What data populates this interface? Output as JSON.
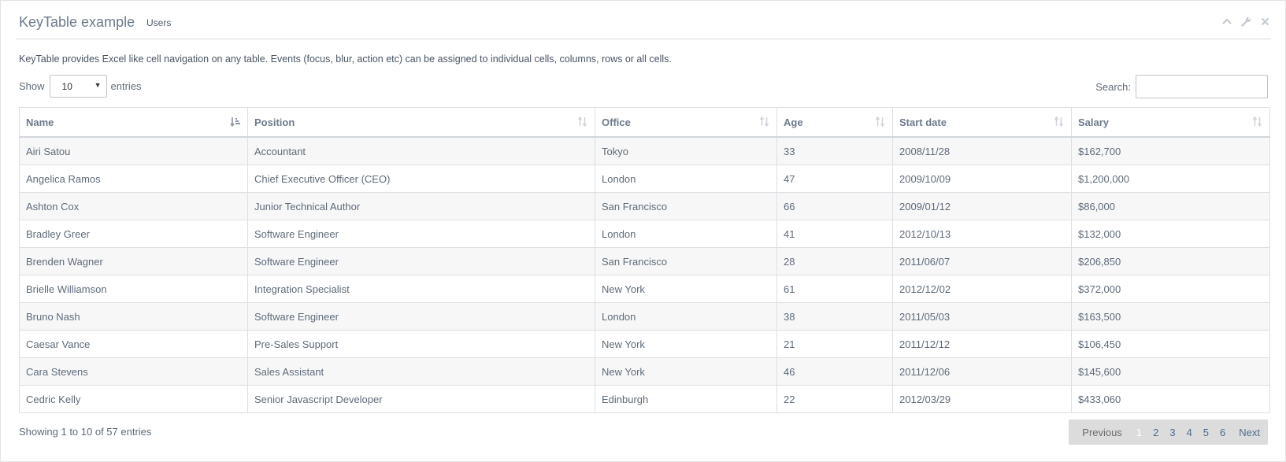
{
  "panel": {
    "title": "KeyTable example",
    "subtitle": "Users",
    "tools": [
      {
        "icon": "chevron-up-icon"
      },
      {
        "icon": "wrench-icon"
      },
      {
        "icon": "close-icon"
      }
    ]
  },
  "description": "KeyTable provides Excel like cell navigation on any table. Events (focus, blur, action etc) can be assigned to individual cells, columns, rows or all cells.",
  "length": {
    "show_label": "Show",
    "selected": "10",
    "entries_label": "entries"
  },
  "search": {
    "label": "Search:",
    "value": "",
    "placeholder": ""
  },
  "table": {
    "columns": [
      "Name",
      "Position",
      "Office",
      "Age",
      "Start date",
      "Salary"
    ],
    "sorted_column": "Name",
    "rows": [
      [
        "Airi Satou",
        "Accountant",
        "Tokyo",
        "33",
        "2008/11/28",
        "$162,700"
      ],
      [
        "Angelica Ramos",
        "Chief Executive Officer (CEO)",
        "London",
        "47",
        "2009/10/09",
        "$1,200,000"
      ],
      [
        "Ashton Cox",
        "Junior Technical Author",
        "San Francisco",
        "66",
        "2009/01/12",
        "$86,000"
      ],
      [
        "Bradley Greer",
        "Software Engineer",
        "London",
        "41",
        "2012/10/13",
        "$132,000"
      ],
      [
        "Brenden Wagner",
        "Software Engineer",
        "San Francisco",
        "28",
        "2011/06/07",
        "$206,850"
      ],
      [
        "Brielle Williamson",
        "Integration Specialist",
        "New York",
        "61",
        "2012/12/02",
        "$372,000"
      ],
      [
        "Bruno Nash",
        "Software Engineer",
        "London",
        "38",
        "2011/05/03",
        "$163,500"
      ],
      [
        "Caesar Vance",
        "Pre-Sales Support",
        "New York",
        "21",
        "2011/12/12",
        "$106,450"
      ],
      [
        "Cara Stevens",
        "Sales Assistant",
        "New York",
        "46",
        "2011/12/06",
        "$145,600"
      ],
      [
        "Cedric Kelly",
        "Senior Javascript Developer",
        "Edinburgh",
        "22",
        "2012/03/29",
        "$433,060"
      ]
    ]
  },
  "info": "Showing 1 to 10 of 57 entries",
  "pagination": {
    "previous": "Previous",
    "pages": [
      "1",
      "2",
      "3",
      "4",
      "5",
      "6"
    ],
    "current": "1",
    "next": "Next"
  },
  "colors": {
    "link": "#4d6d8e",
    "pager_bg": "#dcdcdc",
    "stripe": "#f7f7f7"
  }
}
